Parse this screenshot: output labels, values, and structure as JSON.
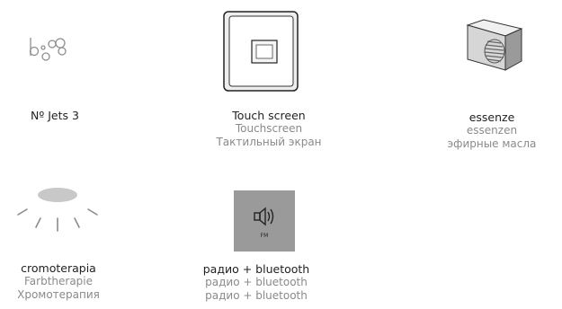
{
  "features": [
    {
      "icon": "jets-icon",
      "lines": [
        "Nº Jets 3"
      ]
    },
    {
      "icon": "touch-screen-icon",
      "lines": [
        "Touch screen",
        "Touchscreen",
        "Тактильный экран"
      ]
    },
    {
      "icon": "essence-diffuser-icon",
      "lines": [
        "essenze",
        "essenzen",
        "эфирные масла"
      ]
    },
    {
      "icon": "chromotherapy-lamp-icon",
      "lines": [
        "cromoterapia",
        "Farbtherapie",
        "Хромотерапия"
      ]
    },
    {
      "icon": "radio-speaker-icon",
      "icon_text": "FM",
      "lines": [
        "радио + bluetooth",
        "радио + bluetooth",
        "радио + bluetooth"
      ]
    }
  ]
}
